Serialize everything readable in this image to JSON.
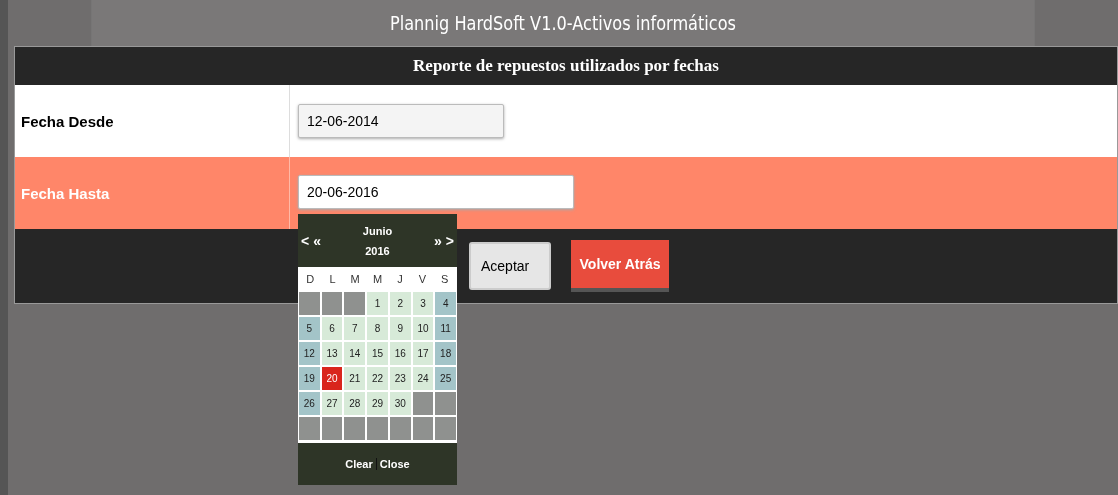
{
  "window": {
    "title": "Plannig HardSoft V1.0-Activos informáticos"
  },
  "form": {
    "heading": "Reporte de repuestos utilizados por fechas",
    "fields": [
      {
        "label": "Fecha Desde",
        "value": "12-06-2014",
        "highlighted": false
      },
      {
        "label": "Fecha Hasta",
        "value": "20-06-2016",
        "highlighted": true
      }
    ],
    "buttons": [
      {
        "label": "Aceptar",
        "kind": "default"
      },
      {
        "label": "Volver Atrás",
        "kind": "danger"
      }
    ]
  },
  "calendar": {
    "month": "Junio",
    "year": "2016",
    "prev_year": "<",
    "prev_month": "«",
    "next_month": "»",
    "next_year": ">",
    "weekdays": [
      "D",
      "L",
      "M",
      "M",
      "J",
      "V",
      "S"
    ],
    "weeks": [
      [
        {
          "kind": "blank"
        },
        {
          "kind": "blank"
        },
        {
          "kind": "blank"
        },
        {
          "day": "1",
          "kind": "weekday",
          "selected": false
        },
        {
          "day": "2",
          "kind": "weekday",
          "selected": false
        },
        {
          "day": "3",
          "kind": "weekday",
          "selected": false
        },
        {
          "day": "4",
          "kind": "weekend",
          "selected": false
        }
      ],
      [
        {
          "day": "5",
          "kind": "weekend",
          "selected": false
        },
        {
          "day": "6",
          "kind": "weekday",
          "selected": false
        },
        {
          "day": "7",
          "kind": "weekday",
          "selected": false
        },
        {
          "day": "8",
          "kind": "weekday",
          "selected": false
        },
        {
          "day": "9",
          "kind": "weekday",
          "selected": false
        },
        {
          "day": "10",
          "kind": "weekday",
          "selected": false
        },
        {
          "day": "11",
          "kind": "weekend",
          "selected": false
        }
      ],
      [
        {
          "day": "12",
          "kind": "weekend",
          "selected": false
        },
        {
          "day": "13",
          "kind": "weekday",
          "selected": false
        },
        {
          "day": "14",
          "kind": "weekday",
          "selected": false
        },
        {
          "day": "15",
          "kind": "weekday",
          "selected": false
        },
        {
          "day": "16",
          "kind": "weekday",
          "selected": false
        },
        {
          "day": "17",
          "kind": "weekday",
          "selected": false
        },
        {
          "day": "18",
          "kind": "weekend",
          "selected": false
        }
      ],
      [
        {
          "day": "19",
          "kind": "weekend",
          "selected": false
        },
        {
          "day": "20",
          "kind": "weekday",
          "selected": true
        },
        {
          "day": "21",
          "kind": "weekday",
          "selected": false
        },
        {
          "day": "22",
          "kind": "weekday",
          "selected": false
        },
        {
          "day": "23",
          "kind": "weekday",
          "selected": false
        },
        {
          "day": "24",
          "kind": "weekday",
          "selected": false
        },
        {
          "day": "25",
          "kind": "weekend",
          "selected": false
        }
      ],
      [
        {
          "day": "26",
          "kind": "weekend",
          "selected": false
        },
        {
          "day": "27",
          "kind": "weekday",
          "selected": false
        },
        {
          "day": "28",
          "kind": "weekday",
          "selected": false
        },
        {
          "day": "29",
          "kind": "weekday",
          "selected": false
        },
        {
          "day": "30",
          "kind": "weekday",
          "selected": false
        },
        {
          "kind": "blank"
        },
        {
          "kind": "blank"
        }
      ],
      [
        {
          "kind": "blank"
        },
        {
          "kind": "blank"
        },
        {
          "kind": "blank"
        },
        {
          "kind": "blank"
        },
        {
          "kind": "blank"
        },
        {
          "kind": "blank"
        },
        {
          "kind": "blank"
        }
      ]
    ],
    "actions": [
      "Clear",
      "Close"
    ]
  }
}
